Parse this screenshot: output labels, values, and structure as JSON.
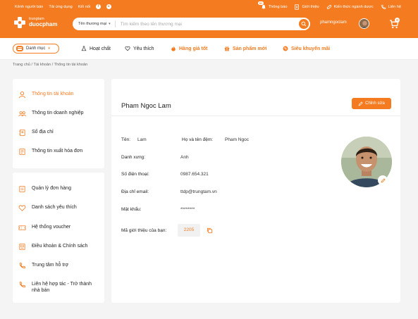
{
  "header": {
    "top_links": [
      "Kênh người bán",
      "Tải ứng dụng",
      "Kết nối"
    ],
    "social_icons": [
      "facebook-icon",
      "youtube-icon"
    ],
    "notif_count": "9+",
    "top_right": [
      "Thông báo",
      "Giới thiệu",
      "Kiến thức ngành dược",
      "Liên hệ"
    ],
    "logo_line1": "trungtam",
    "logo_line2": "duocpham",
    "search_category": "Tên thương mại",
    "search_placeholder": "Tìm kiếm theo tên thương mại",
    "username": "phamngoclam",
    "cart_count": "0",
    "brand_color": "#f47b20"
  },
  "nav": {
    "menu_label": "Danh mục",
    "items": [
      "Hoạt chất",
      "Yêu thích",
      "Hàng giá tốt",
      "Sản phẩm mới",
      "Siêu khuyến mãi"
    ]
  },
  "breadcrumb": "Trang chủ / Tài khoản / Thông tin tài khoản",
  "sidebar": {
    "group1": [
      "Thông tin tài khoản",
      "Thông tin doanh nghiệp",
      "Sổ địa chỉ",
      "Thông tin xuất hóa đơn"
    ],
    "group2": [
      "Quản lý đơn hàng",
      "Danh sách yêu thích",
      "Hệ thống voucher",
      "Điều khoản & Chính sách",
      "Trung tâm hỗ trợ",
      "Liên hệ hợp tác - Trở thành nhà bán"
    ]
  },
  "profile": {
    "title": "Pham Ngoc Lam",
    "edit_label": "Chỉnh sửa",
    "first_name_label": "Tên:",
    "first_name": "Lam",
    "last_name_label": "Họ và tên đệm:",
    "last_name": "Pham Ngoc",
    "title_label": "Danh xưng:",
    "honorific": "Anh",
    "phone_label": "Số điện thoại:",
    "phone": "0987.654.321",
    "email_label": "Địa chỉ email:",
    "email": "ttdp@trungtam.vn",
    "password_label": "Mật khẩu:",
    "password": "********",
    "referral_label": "Mã giới thiệu của bạn:",
    "referral_code": "2205"
  }
}
